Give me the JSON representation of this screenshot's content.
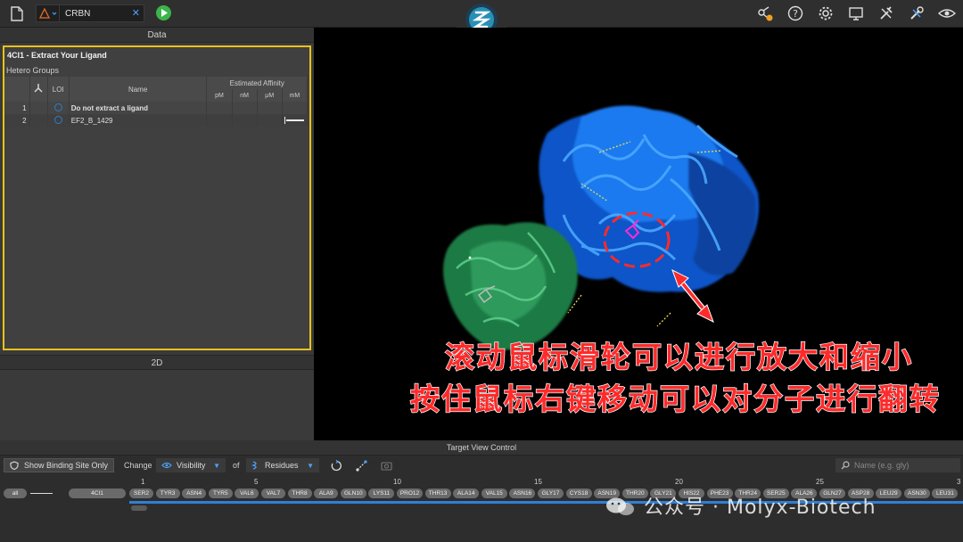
{
  "toolbar": {
    "tab_label": "CRBN",
    "right_icons": [
      "molecule-alert-icon",
      "help-icon",
      "settings-icon",
      "monitor-icon",
      "tools-icon",
      "wrench-icon",
      "eye-icon"
    ]
  },
  "left": {
    "data_header": "Data",
    "ligand_title": "4CI1 - Extract Your Ligand",
    "hetero_label": "Hetero Groups",
    "columns": {
      "loi": "LOI",
      "name": "Name",
      "affinity": "Estimated Affinity"
    },
    "affinity_units": [
      "pM",
      "nM",
      "μM",
      "mM"
    ],
    "rows": [
      {
        "num": "1",
        "name": "Do not extract a ligand"
      },
      {
        "num": "2",
        "name": "EF2_B_1429"
      }
    ],
    "twod_header": "2D"
  },
  "viewer": {
    "cn_line1": "滚动鼠标滑轮可以进行放大和缩小",
    "cn_line2": "按住鼠标右键移动可以对分子进行翻转"
  },
  "bottom": {
    "title": "Target View Control",
    "show_binding": "Show Binding Site Only",
    "change": "Change",
    "visibility": "Visibility",
    "of": "of",
    "residues": "Residues",
    "search_placeholder": "Name (e.g. gly)",
    "all_chip": "all",
    "chain_chip": "4CI1",
    "ruler": [
      "1",
      "5",
      "10",
      "15",
      "20",
      "25",
      "3"
    ],
    "residues_list": [
      "SER2",
      "TYR3",
      "ASN4",
      "TYR5",
      "VAL6",
      "VAL7",
      "THR8",
      "ALA9",
      "GLN10",
      "LYS11",
      "PRO12",
      "THR13",
      "ALA14",
      "VAL15",
      "ASN16",
      "GLY17",
      "CYS18",
      "ASN19",
      "THR20",
      "GLY21",
      "HIS22",
      "PHE23",
      "THR24",
      "SER25",
      "ALA26",
      "GLN27",
      "ASP28",
      "LEU29",
      "ASN30",
      "LEU31"
    ]
  },
  "watermark": "公众号 · Molyx-Biotech",
  "colors": {
    "accent": "#e8c21c",
    "link": "#4aa3ff",
    "annotation": "#ff2a2a"
  }
}
